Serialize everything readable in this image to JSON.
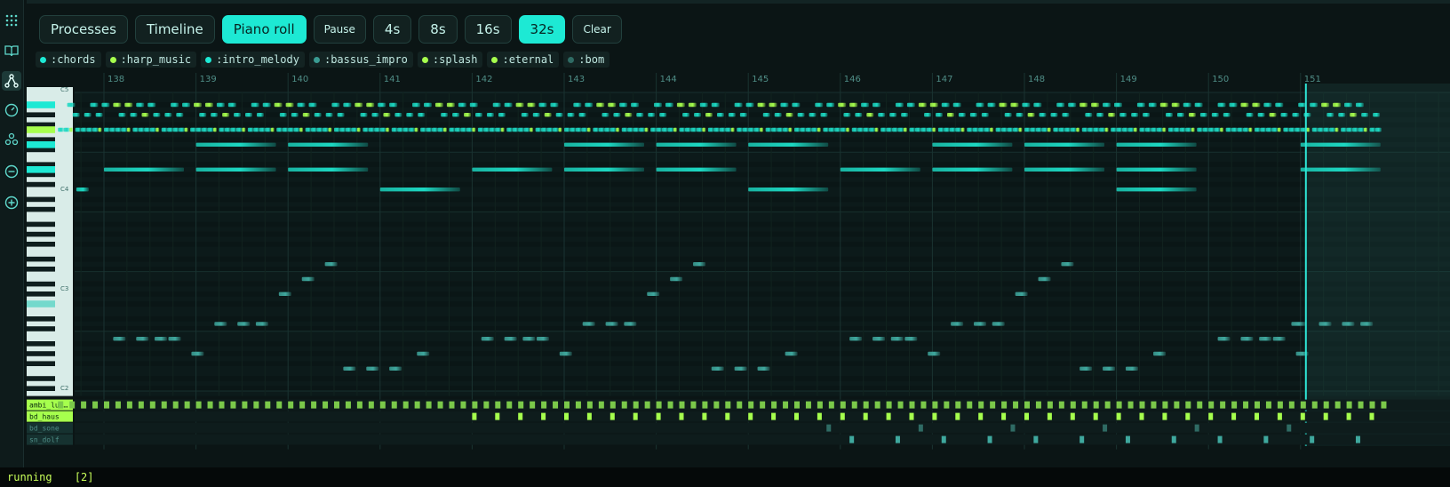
{
  "toolbar": {
    "tabs": [
      {
        "label": "Processes",
        "name": "tab-processes",
        "active": false,
        "small": false
      },
      {
        "label": "Timeline",
        "name": "tab-timeline",
        "active": false,
        "small": false
      },
      {
        "label": "Piano roll",
        "name": "tab-piano-roll",
        "active": true,
        "small": false
      },
      {
        "label": "Pause",
        "name": "pause-button",
        "active": false,
        "small": true
      },
      {
        "label": "4s",
        "name": "window-4s-button",
        "active": false,
        "small": false
      },
      {
        "label": "8s",
        "name": "window-8s-button",
        "active": false,
        "small": false
      },
      {
        "label": "16s",
        "name": "window-16s-button",
        "active": false,
        "small": false
      },
      {
        "label": "32s",
        "name": "window-32s-button",
        "active": true,
        "small": false
      },
      {
        "label": "Clear",
        "name": "clear-button",
        "active": false,
        "small": true
      }
    ]
  },
  "sidebar": {
    "icons": [
      "grid-icon",
      "book-icon",
      "network-icon",
      "gauge-icon",
      "nodes-icon",
      "minus-circle-icon",
      "plus-circle-icon"
    ],
    "active": "network-icon"
  },
  "channels": [
    {
      "label": ":chords",
      "color": "#1de9d4"
    },
    {
      "label": ":harp_music",
      "color": "#a6ff4d"
    },
    {
      "label": ":intro_melody",
      "color": "#1de9d4"
    },
    {
      "label": ":bassus_impro",
      "color": "#3a9b92"
    },
    {
      "label": ":splash",
      "color": "#a6ff4d"
    },
    {
      "label": ":eternal",
      "color": "#a6ff4d"
    },
    {
      "label": ":bom",
      "color": "#2f6b64"
    }
  ],
  "roll": {
    "bar_numbers": [
      "138",
      "139",
      "140",
      "141",
      "142",
      "143",
      "144",
      "145",
      "146",
      "147",
      "148",
      "149",
      "150",
      "151"
    ],
    "octave_labels": [
      "C5",
      "C4",
      "C3",
      "C2"
    ],
    "drum_tracks": [
      "ambi_lun…",
      "bd_haus",
      "bd_sone",
      "sn_dolf"
    ],
    "playhead_bar": 151,
    "colors": {
      "note_teal": "#1cd8c2",
      "note_green": "#a6ff4d",
      "note_mid": "#3fa89e",
      "playhead": "#2ee6d6"
    }
  },
  "status": {
    "state": "running",
    "count": "[2]"
  }
}
